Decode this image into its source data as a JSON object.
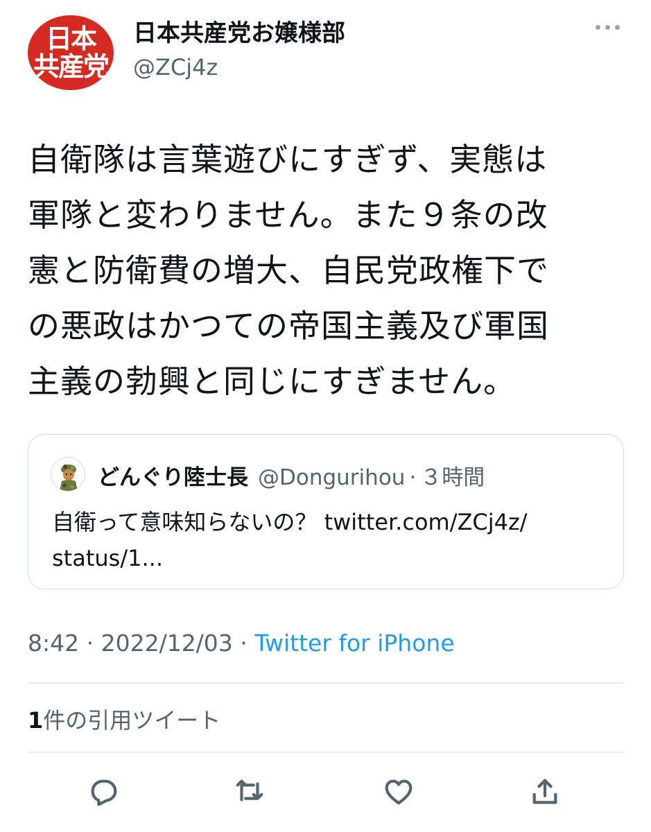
{
  "tweet": {
    "avatar": {
      "text_line1": "日本",
      "text_line2": "共産党",
      "color": "#d42a22"
    },
    "author_name": "日本共産党お嬢様部",
    "author_handle": "@ZCj4z",
    "text_lines": [
      "自衛隊は言葉遊びにすぎず、実態は",
      "軍隊と変わりません。また９条の改",
      "憲と防衛費の増大、自民党政権下で",
      "の悪政はかつての帝国主義及び軍国",
      "主義の勃興と同じにすぎません。"
    ],
    "quoted": {
      "author_name": "どんぐり陸士長",
      "author_handle": "@Dongurihou",
      "separator": "·",
      "time": "３時間",
      "text_line1": "自衛って意味知らないの？ twitter.com/ZCj4z/",
      "text_line2": "status/1..."
    },
    "meta": {
      "time": "8:42",
      "sep1": " · ",
      "date": "2022/12/03",
      "sep2": " · ",
      "source": "Twitter for iPhone"
    },
    "stats": {
      "quote_count": "1",
      "quote_label": "件の引用ツイート"
    }
  },
  "actions": {
    "reply": "reply-icon",
    "retweet": "retweet-icon",
    "like": "heart-icon",
    "share": "share-icon"
  },
  "colors": {
    "link": "#1d9bf0",
    "secondary_text": "#536471",
    "border": "#cfd9de"
  }
}
